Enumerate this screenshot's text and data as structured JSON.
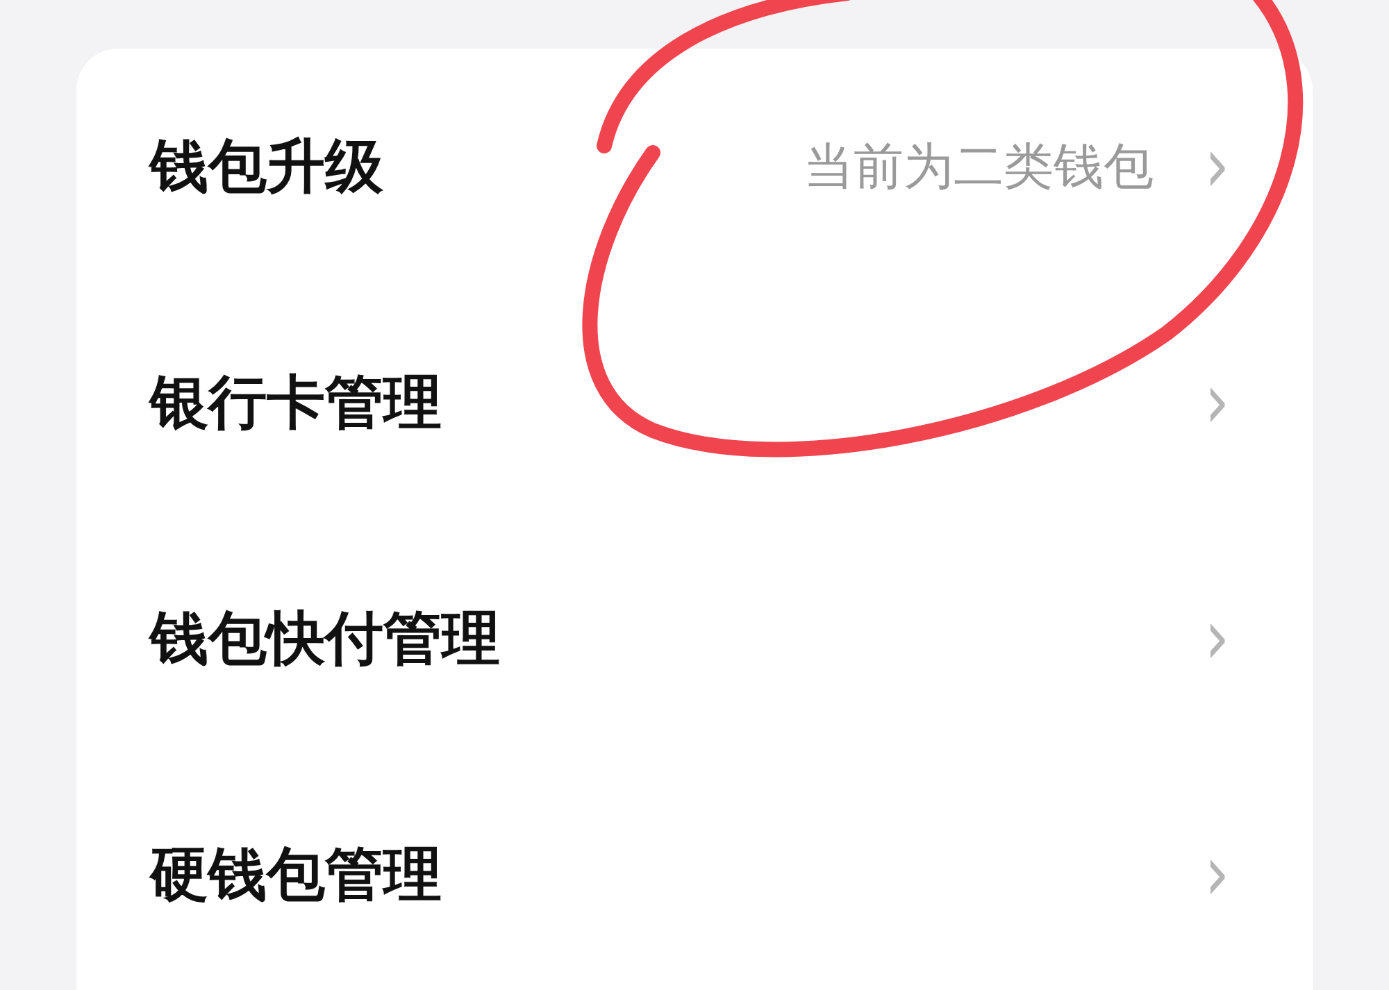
{
  "settings_list": [
    {
      "label": "钱包升级",
      "value": "当前为二类钱包",
      "chevron": "›"
    },
    {
      "label": "银行卡管理",
      "chevron": "›"
    },
    {
      "label": "钱包快付管理",
      "chevron": "›"
    },
    {
      "label": "硬钱包管理",
      "chevron": "›"
    }
  ]
}
